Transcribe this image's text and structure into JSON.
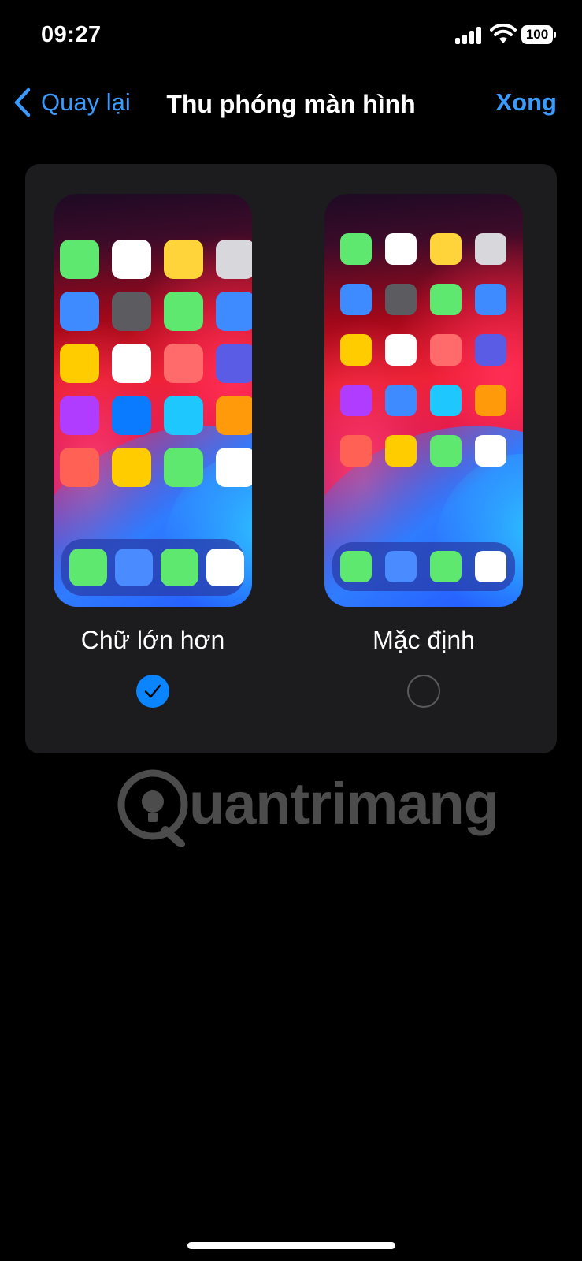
{
  "status_bar": {
    "time": "09:27",
    "battery": "100"
  },
  "nav": {
    "back_label": "Quay lại",
    "title": "Thu phóng màn hình",
    "done_label": "Xong"
  },
  "options": [
    {
      "label": "Chữ lớn hơn",
      "selected": true
    },
    {
      "label": "Mặc định",
      "selected": false
    }
  ],
  "watermark": "uantrimang",
  "colors": {
    "accent": "#0a84ff",
    "link": "#3a9bff",
    "card": "#1c1c1e"
  },
  "icons": {
    "back": "chevron-left-icon",
    "selected": "checkmark-icon",
    "signal": "cellular-signal-icon",
    "wifi": "wifi-icon",
    "battery": "battery-icon"
  }
}
